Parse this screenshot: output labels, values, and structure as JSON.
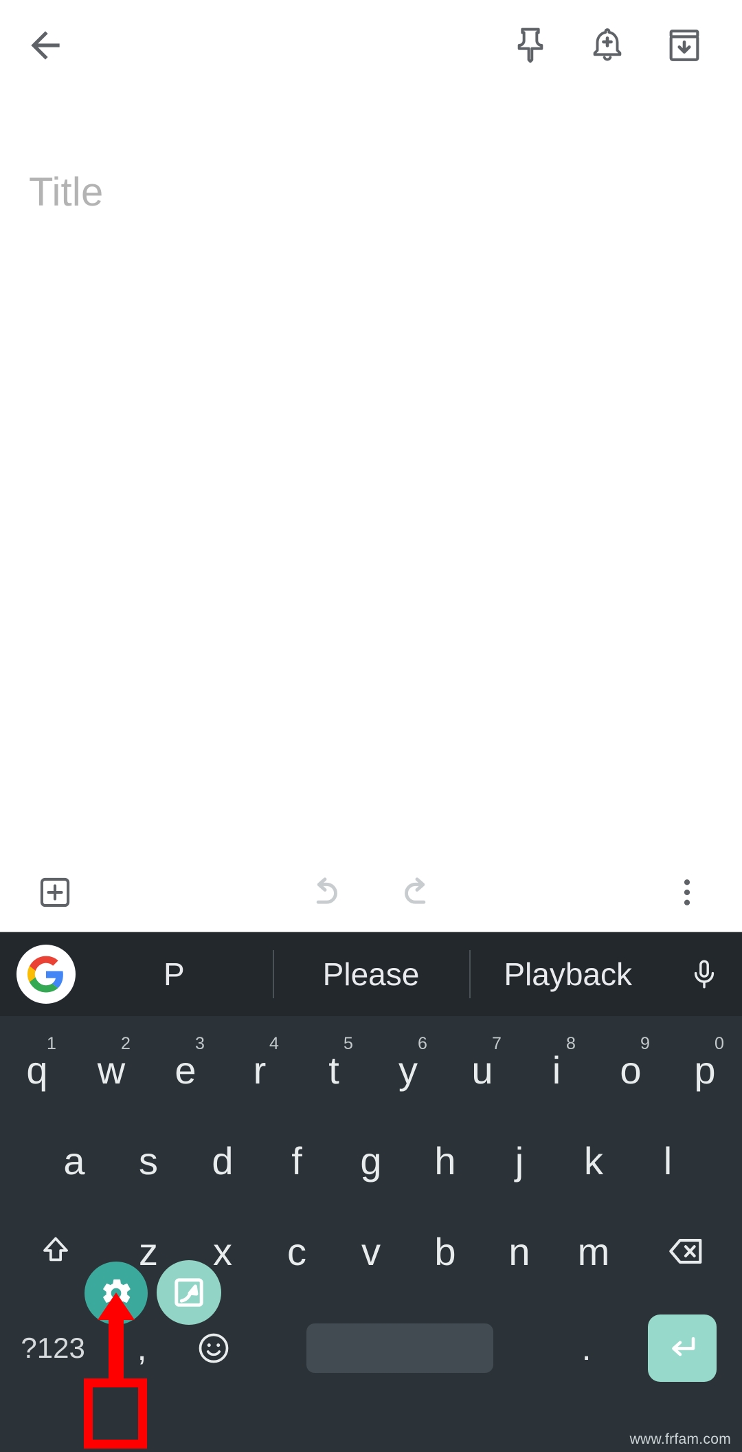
{
  "app": {
    "name": "google-keep-note-editor",
    "background_color": "#ffffff"
  },
  "note_topbar": {
    "back_label": "back-arrow",
    "actions": [
      {
        "name": "pin",
        "icon": "pin-icon",
        "label": "Pin note"
      },
      {
        "name": "reminder",
        "icon": "add-alert-icon",
        "label": "Add reminder"
      },
      {
        "name": "archive",
        "icon": "archive-icon",
        "label": "Archive"
      }
    ]
  },
  "note": {
    "title_placeholder": "Title",
    "title_value": "",
    "body_placeholder": "",
    "body_value": ""
  },
  "note_bottombar": {
    "add_label": "add-box-icon",
    "undo_label": "undo-icon",
    "redo_label": "redo-icon",
    "more_label": "more-vert-icon",
    "undo_enabled": "false",
    "redo_enabled": "false"
  },
  "keyboard": {
    "background_color": "#2b3338",
    "suggestion_bar_color": "#22282c",
    "key_text_color": "#e9eced",
    "suggestion_bar": {
      "logo": "google-g-logo",
      "mic": "microphone-icon",
      "suggestions": [
        "P",
        "Please",
        "Playback"
      ]
    },
    "rows": {
      "row1": [
        {
          "key": "q",
          "hint": "1"
        },
        {
          "key": "w",
          "hint": "2"
        },
        {
          "key": "e",
          "hint": "3"
        },
        {
          "key": "r",
          "hint": "4"
        },
        {
          "key": "t",
          "hint": "5"
        },
        {
          "key": "y",
          "hint": "6"
        },
        {
          "key": "u",
          "hint": "7"
        },
        {
          "key": "i",
          "hint": "8"
        },
        {
          "key": "o",
          "hint": "9"
        },
        {
          "key": "p",
          "hint": "0"
        }
      ],
      "row2": [
        {
          "key": "a"
        },
        {
          "key": "s"
        },
        {
          "key": "d"
        },
        {
          "key": "f"
        },
        {
          "key": "g"
        },
        {
          "key": "h"
        },
        {
          "key": "j"
        },
        {
          "key": "k"
        },
        {
          "key": "l"
        }
      ],
      "row3": [
        {
          "key": "shift",
          "icon": "shift-arrow-icon",
          "label": ""
        },
        {
          "key": "z"
        },
        {
          "key": "x"
        },
        {
          "key": "c"
        },
        {
          "key": "v"
        },
        {
          "key": "b"
        },
        {
          "key": "n"
        },
        {
          "key": "m"
        },
        {
          "key": "backspace",
          "icon": "backspace-icon",
          "label": ""
        }
      ],
      "row4": {
        "symbols_label": "?123",
        "comma_label": ",",
        "emoji_label": "emoji-smiley-icon",
        "space_label": "",
        "period_label": ".",
        "enter_label": "enter-arrow-icon"
      }
    }
  },
  "annotations": {
    "gear_circle": {
      "icon": "gear-icon",
      "color": "#3ba99c",
      "covers_key": "z"
    },
    "swipe_circle": {
      "icon": "glide-typing-icon",
      "color": "#92d5c6",
      "covers_key": "x"
    },
    "arrow": {
      "color": "#fe0000",
      "direction": "up"
    },
    "highlight_rect": {
      "color": "#fe0000",
      "target_key": ","
    }
  },
  "watermark": {
    "text": "www.frfam.com"
  }
}
